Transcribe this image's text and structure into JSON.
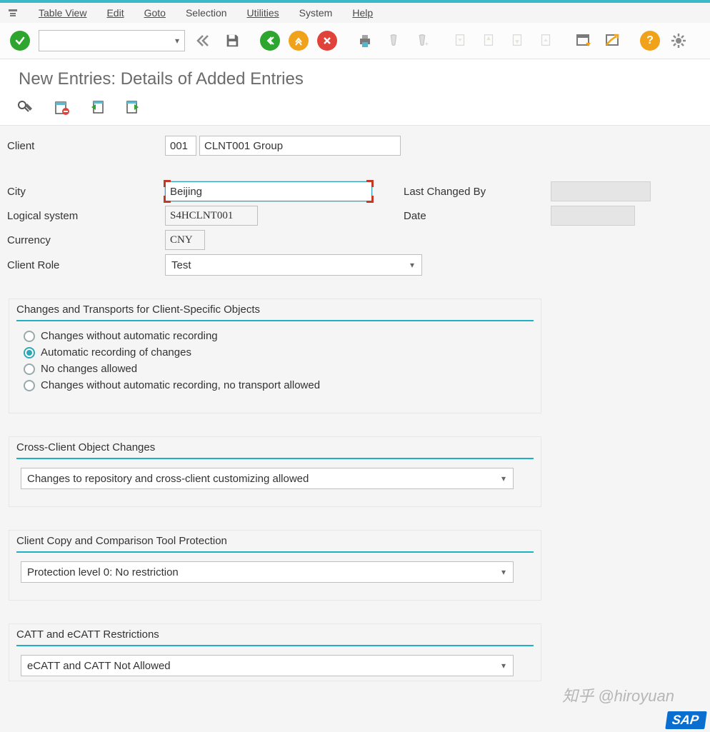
{
  "menu": {
    "items": [
      "Table View",
      "Edit",
      "Goto",
      "Selection",
      "Utilities",
      "System",
      "Help"
    ]
  },
  "page_title": "New Entries: Details of Added Entries",
  "fields": {
    "client_label": "Client",
    "client_value": "001",
    "client_desc": "CLNT001 Group",
    "city_label": "City",
    "city_value": "Beijing",
    "logical_system_label": "Logical system",
    "logical_system_value": "S4HCLNT001",
    "currency_label": "Currency",
    "currency_value": "CNY",
    "client_role_label": "Client Role",
    "client_role_value": "Test",
    "last_changed_label": "Last Changed By",
    "last_changed_value": "",
    "date_label": "Date",
    "date_value": ""
  },
  "sections": {
    "changes_transports": {
      "title": "Changes and Transports for Client-Specific Objects",
      "options": [
        "Changes without automatic recording",
        "Automatic recording of changes",
        "No changes allowed",
        "Changes without automatic recording, no transport allowed"
      ],
      "selected_index": 1
    },
    "cross_client": {
      "title": "Cross-Client Object Changes",
      "value": "Changes to repository and cross-client customizing allowed"
    },
    "copy_protection": {
      "title": "Client Copy and Comparison Tool Protection",
      "value": "Protection level 0: No restriction"
    },
    "catt": {
      "title": "CATT and eCATT Restrictions",
      "value": "eCATT and CATT Not Allowed"
    }
  },
  "watermark": "知乎 @hiroyuan",
  "logo": "SAP"
}
